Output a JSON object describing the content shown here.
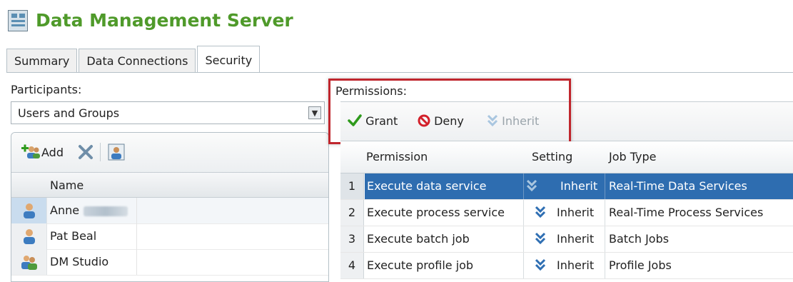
{
  "app": {
    "title": "Data Management Server"
  },
  "tabs": [
    {
      "label": "Summary",
      "active": false
    },
    {
      "label": "Data Connections",
      "active": false
    },
    {
      "label": "Security",
      "active": true
    }
  ],
  "participants": {
    "label": "Participants:",
    "select_value": "Users and Groups",
    "toolbar": {
      "add_label": "Add"
    },
    "column_name": "Name",
    "users": [
      {
        "name": "Anne",
        "icon": "user-icon",
        "selected": true
      },
      {
        "name": "Pat Beal",
        "icon": "user-icon",
        "selected": false
      },
      {
        "name": "DM Studio",
        "icon": "group-icon",
        "selected": false
      }
    ]
  },
  "permissions": {
    "label": "Permissions:",
    "toolbar": {
      "grant": "Grant",
      "deny": "Deny",
      "inherit": "Inherit"
    },
    "columns": [
      "Permission",
      "Setting",
      "Job Type"
    ],
    "rows": [
      {
        "num": "1",
        "permission": "Execute data service",
        "setting": "Inherit",
        "job_type": "Real-Time Data Services",
        "selected": true
      },
      {
        "num": "2",
        "permission": "Execute process service",
        "setting": "Inherit",
        "job_type": "Real-Time Process Services",
        "selected": false
      },
      {
        "num": "3",
        "permission": "Execute batch job",
        "setting": "Inherit",
        "job_type": "Batch Jobs",
        "selected": false
      },
      {
        "num": "4",
        "permission": "Execute profile job",
        "setting": "Inherit",
        "job_type": "Profile Jobs",
        "selected": false
      }
    ]
  },
  "colors": {
    "title_green": "#4f9a2a",
    "highlight_red": "#c0262d",
    "selection_blue": "#2e6db0",
    "grant_green": "#2e9a1c",
    "deny_red": "#d3202a",
    "inherit_blue": "#2f6fb3"
  }
}
